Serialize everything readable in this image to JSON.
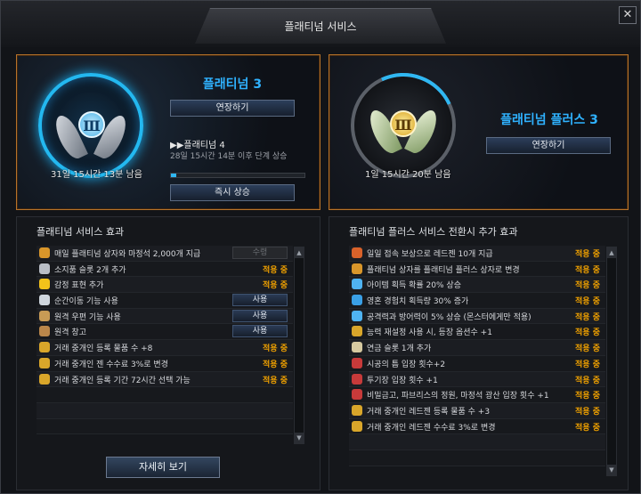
{
  "window": {
    "title": "플래티넘 서비스",
    "close_label": "✕"
  },
  "left_card": {
    "emblem_numeral": "Ⅲ",
    "remaining": "31일 15시간 13분 남음",
    "tier_title": "플래티넘 3",
    "extend_button": "연장하기",
    "next_tier_label": "▶▶플래티넘 4",
    "next_tier_sub": "28일 15시간 14분 이후 단계 상승",
    "progress": 0.04,
    "instant_button": "즉시 상승"
  },
  "right_card": {
    "emblem_numeral": "Ⅲ",
    "remaining": "1일 15시간 20분 남음",
    "tier_title": "플래티넘 플러스 3",
    "extend_button": "연장하기",
    "progress": 0.12
  },
  "left_panel": {
    "title": "플래티넘 서비스 효과",
    "rows": [
      {
        "icon": "gift-box-icon",
        "icon_color": "#d9962a",
        "text": "매일 플래티넘 상자와 마정석 2,000개 지급",
        "button": "수령",
        "button_disabled": true
      },
      {
        "icon": "slot-icon",
        "icon_color": "#b9bec6",
        "text": "소지품 슬롯 2개 추가",
        "status": "적용 중"
      },
      {
        "icon": "emotion-icon",
        "icon_color": "#f2c21a",
        "text": "감정 표현 추가",
        "status": "적용 중"
      },
      {
        "icon": "teleport-icon",
        "icon_color": "#cfd6dd",
        "text": "순간이동 기능 사용",
        "button": "사용"
      },
      {
        "icon": "mail-icon",
        "icon_color": "#c89b55",
        "text": "원격 우편 기능 사용",
        "button": "사용"
      },
      {
        "icon": "storage-icon",
        "icon_color": "#b9864a",
        "text": "원격 창고",
        "button": "사용"
      },
      {
        "icon": "scales-icon",
        "icon_color": "#d9a62a",
        "text": "거래 중개인 등록 물품 수 +8",
        "status": "적용 중"
      },
      {
        "icon": "scales-icon",
        "icon_color": "#d9a62a",
        "text": "거래 중개인 젠 수수료 3%로 변경",
        "status": "적용 중"
      },
      {
        "icon": "scales-icon",
        "icon_color": "#d9a62a",
        "text": "거래 중개인 등록 기간 72시간 선택 가능",
        "status": "적용 중"
      }
    ],
    "details_button": "자세히 보기"
  },
  "right_panel": {
    "title": "플래티넘 플러스 서비스 전환시 추가 효과",
    "rows": [
      {
        "icon": "reward-icon",
        "icon_color": "#d9622a",
        "text": "일일 접속 보상으로 레드젠 10개 지급",
        "status": "적용 중"
      },
      {
        "icon": "gift-box-icon",
        "icon_color": "#d9962a",
        "text": "플래티넘 상자를 플래티넘 플러스 상자로 변경",
        "status": "적용 중"
      },
      {
        "icon": "arrow-up-icon",
        "icon_color": "#4fb3f2",
        "text": "아이템 획득 확률 20% 상승",
        "status": "적용 중"
      },
      {
        "icon": "soul-icon",
        "icon_color": "#3aa0e6",
        "text": "영혼 경험치 획득량 30% 증가",
        "status": "적용 중"
      },
      {
        "icon": "arrow-up-icon",
        "icon_color": "#4fb3f2",
        "text": "공격력과 방어력이 5% 상승 (몬스터에게만 적용)",
        "status": "적용 중"
      },
      {
        "icon": "swap-icon",
        "icon_color": "#d9a62a",
        "text": "능력 재설정 사용 시, 등장 옵션수 +1",
        "status": "적용 중"
      },
      {
        "icon": "slot-icon",
        "icon_color": "#d6c9a0",
        "text": "연금 슬롯 1개 추가",
        "status": "적용 중"
      },
      {
        "icon": "dungeon-icon",
        "icon_color": "#c73a3a",
        "text": "시공의 틈 입장 횟수+2",
        "status": "적용 중"
      },
      {
        "icon": "dungeon-icon",
        "icon_color": "#c73a3a",
        "text": "투기장 입장 횟수 +1",
        "status": "적용 중"
      },
      {
        "icon": "dungeon-icon",
        "icon_color": "#c73a3a",
        "text": "비밀금고, 파브리스의 정원, 마정석 광산 입장 횟수 +1",
        "status": "적용 중"
      },
      {
        "icon": "scales-icon",
        "icon_color": "#d9a62a",
        "text": "거래 중개인 레드젠 등록 물품 수 +3",
        "status": "적용 중"
      },
      {
        "icon": "scales-icon",
        "icon_color": "#d9a62a",
        "text": "거래 중개인 레드젠 수수료 3%로 변경",
        "status": "적용 중"
      }
    ]
  }
}
